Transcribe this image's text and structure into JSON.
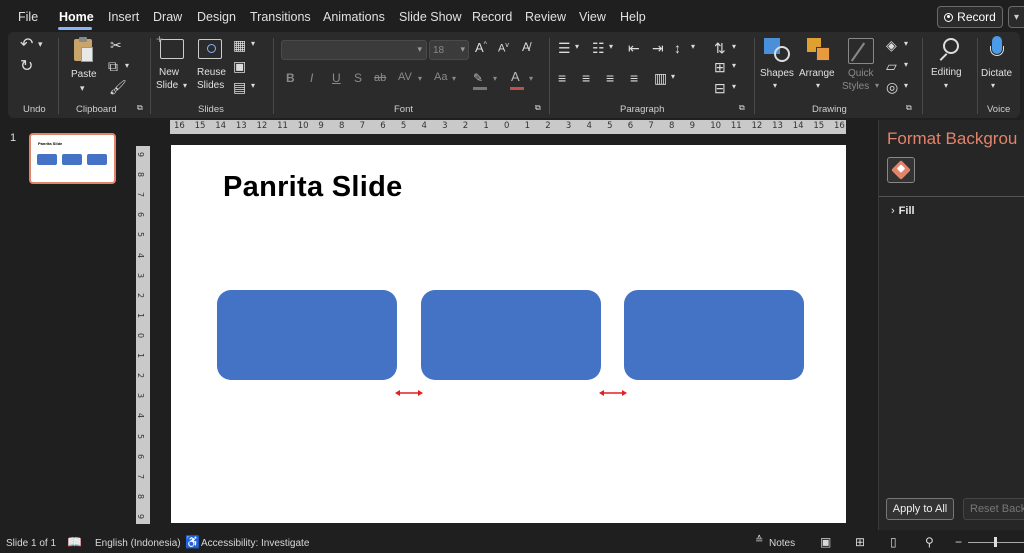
{
  "menu": {
    "tabs": [
      "File",
      "Home",
      "Insert",
      "Draw",
      "Design",
      "Transitions",
      "Animations",
      "Slide Show",
      "Record",
      "Review",
      "View",
      "Help"
    ],
    "active_tab": "Home",
    "record_label": "Record"
  },
  "ribbon": {
    "groups": {
      "undo": "Undo",
      "clipboard": "Clipboard",
      "slides": "Slides",
      "font": "Font",
      "paragraph": "Paragraph",
      "drawing": "Drawing",
      "voice": "Voice"
    },
    "paste_label": "Paste",
    "new_slide_line1": "New",
    "new_slide_line2": "Slide",
    "reuse_slides_line1": "Reuse",
    "reuse_slides_line2": "Slides",
    "font_name_value": "",
    "font_size_value": "18",
    "shapes_label": "Shapes",
    "arrange_label": "Arrange",
    "quick_styles_line1": "Quick",
    "quick_styles_line2": "Styles",
    "editing_label": "Editing",
    "dictate_label": "Dictate",
    "font_buttons": [
      "B",
      "I",
      "U",
      "S",
      "ab",
      "AV",
      "Aa"
    ],
    "grow_font": "A",
    "shrink_font": "A"
  },
  "thumbnails": {
    "slide_number": "1",
    "thumb_title": "Panrita Slide"
  },
  "rulers": {
    "horizontal": [
      "16",
      "15",
      "14",
      "13",
      "12",
      "11",
      "10",
      "9",
      "8",
      "7",
      "6",
      "5",
      "4",
      "3",
      "2",
      "1",
      "0",
      "1",
      "2",
      "3",
      "4",
      "5",
      "6",
      "7",
      "8",
      "9",
      "10",
      "11",
      "12",
      "13",
      "14",
      "15",
      "16"
    ],
    "vertical": [
      "9",
      "8",
      "7",
      "6",
      "5",
      "4",
      "3",
      "2",
      "1",
      "0",
      "1",
      "2",
      "3",
      "4",
      "5",
      "6",
      "7",
      "8",
      "9"
    ]
  },
  "slide": {
    "title": "Panrita Slide",
    "box_color": "#4472c4",
    "arrow_color": "#e02020"
  },
  "format_pane": {
    "title": "Format Backgrou",
    "fill_label": "Fill",
    "apply_all": "Apply to All",
    "reset": "Reset Backgro"
  },
  "status": {
    "slide_info": "Slide 1 of 1",
    "language": "English (Indonesia)",
    "accessibility": "Accessibility: Investigate",
    "notes": "Notes"
  },
  "colors": {
    "accent": "#e1846b",
    "ribbon_bg": "#2b2b2b",
    "app_bg": "#1f1f1f"
  }
}
